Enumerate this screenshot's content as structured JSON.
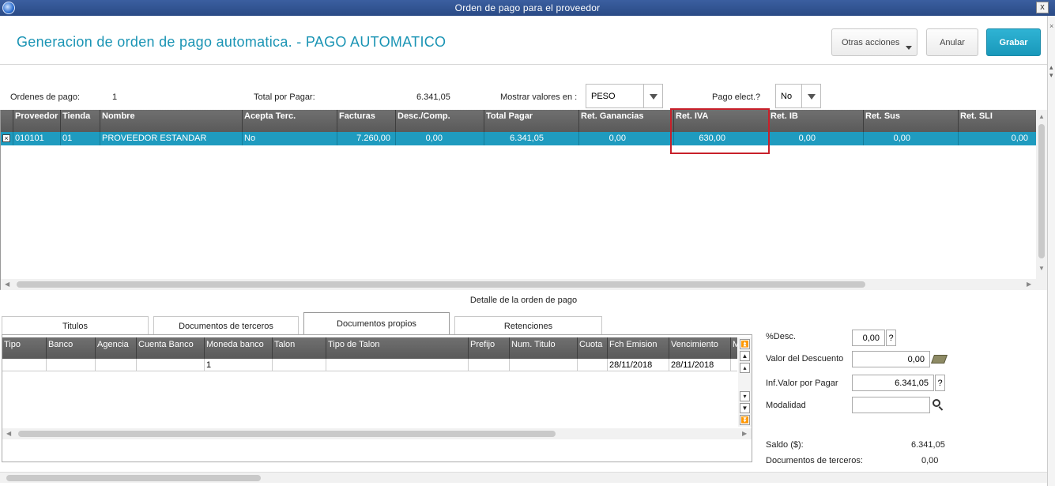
{
  "window": {
    "title": "Orden de pago para el proveedor",
    "close": "x"
  },
  "header": {
    "title": "Generacion de orden de pago automatica. - PAGO AUTOMATICO",
    "buttons": {
      "otras": "Otras acciones",
      "anular": "Anular",
      "grabar": "Grabar"
    }
  },
  "summary": {
    "ordenes_label": "Ordenes de pago:",
    "ordenes_value": "1",
    "total_label": "Total por Pagar:",
    "total_value": "6.341,05",
    "mostrar_label": "Mostrar valores en :",
    "mostrar_value": "PESO",
    "pago_label": "Pago elect.?",
    "pago_value": "No"
  },
  "grid": {
    "columns": [
      "Proveedor",
      "Tienda",
      "Nombre",
      "Acepta Terc.",
      "Facturas",
      "Desc./Comp.",
      "Total Pagar",
      "Ret. Ganancias",
      "Ret. IVA",
      "Ret. IB",
      "Ret. Sus",
      "Ret. SLI"
    ],
    "row": [
      "010101",
      "01",
      "PROVEEDOR ESTANDAR",
      "No",
      "7.260,00",
      "0,00",
      "6.341,05",
      "0,00",
      "630,00",
      "0,00",
      "0,00",
      "0,00"
    ],
    "check_mark": "×"
  },
  "detail": {
    "title": "Detalle de la orden de pago",
    "tabs": [
      "Titulos",
      "Documentos de terceros",
      "Documentos propios",
      "Retenciones"
    ],
    "columns": [
      "Tipo",
      "Banco",
      "Agencia",
      "Cuenta Banco",
      "Moneda banco",
      "Talon",
      "Tipo de Talon",
      "Prefijo",
      "Num. Titulo",
      "Cuota",
      "Fch Emision",
      "Vencimiento",
      "M"
    ],
    "row": [
      "",
      "",
      "",
      "",
      "1",
      "",
      "",
      "",
      "",
      "",
      "28/11/2018",
      "28/11/2018",
      ""
    ]
  },
  "form": {
    "desc_label": "%Desc.",
    "desc_value": "0,00",
    "valor_desc_label": "Valor del Descuento",
    "valor_desc_value": "0,00",
    "inf_valor_label": "Inf.Valor por Pagar",
    "inf_valor_value": "6.341,05",
    "modalidad_label": "Modalidad",
    "modalidad_value": "",
    "help": "?",
    "saldo_label": "Saldo ($):",
    "saldo_value": "6.341,05",
    "doc_terceros_label": "Documentos de terceros:",
    "doc_terceros_value": "0,00"
  },
  "icons": {
    "close": "close-icon",
    "money": "money-icon",
    "search": "search-icon"
  }
}
